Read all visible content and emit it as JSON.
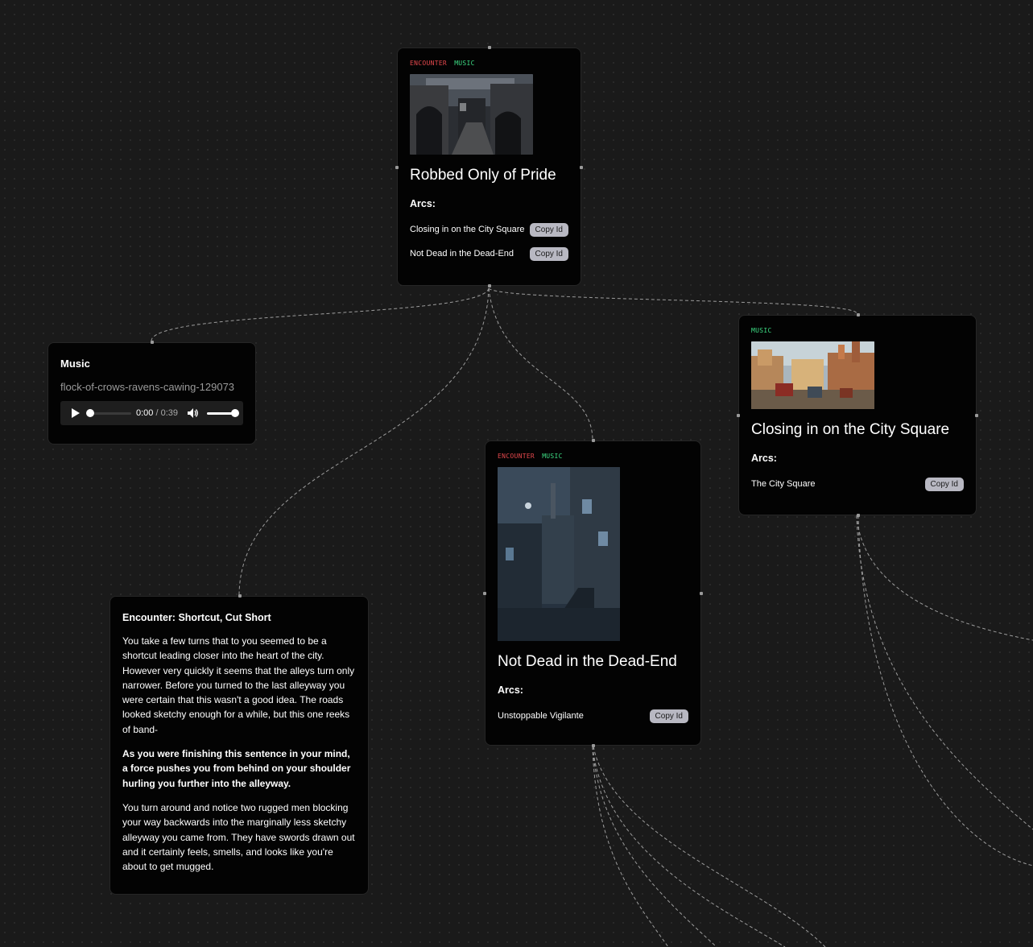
{
  "nodes": {
    "robbed": {
      "tags": [
        "ENCOUNTER",
        "MUSIC"
      ],
      "title": "Robbed Only of Pride",
      "arcs_label": "Arcs:",
      "arcs": [
        {
          "label": "Closing in on the City Square",
          "button": "Copy Id"
        },
        {
          "label": "Not Dead in the Dead-End",
          "button": "Copy Id"
        }
      ]
    },
    "music": {
      "title": "Music",
      "file": "flock-of-crows-ravens-cawing-129073",
      "current_time": "0:00",
      "duration": "/ 0:39",
      "progress": 0,
      "volume": 1
    },
    "city_square": {
      "tags": [
        "MUSIC"
      ],
      "title": "Closing in on the City Square",
      "arcs_label": "Arcs:",
      "arcs": [
        {
          "label": "The City Square",
          "button": "Copy Id"
        }
      ]
    },
    "dead_end": {
      "tags": [
        "ENCOUNTER",
        "MUSIC"
      ],
      "title": "Not Dead in the Dead-End",
      "arcs_label": "Arcs:",
      "arcs": [
        {
          "label": "Unstoppable Vigilante",
          "button": "Copy Id"
        }
      ]
    },
    "encounter": {
      "heading": "Encounter: Shortcut, Cut Short",
      "paragraphs": [
        "You take a few turns that to you seemed to be a shortcut leading closer into the heart of the city. However very quickly it seems that the alleys turn only narrower. Before you turned to the last alleyway you were certain that this wasn't a good idea. The roads looked sketchy enough for a while, but this one reeks of band-",
        "As you were finishing this sentence in your mind, a force pushes you from behind on your shoulder hurling you further into the alleyway.",
        "You turn around and notice two rugged men blocking your way backwards into the marginally less sketchy alleyway you came from. They have swords drawn out and it certainly feels, smells, and looks like you're about to get mugged."
      ]
    }
  },
  "colors": {
    "canvas": "#1a1a1a",
    "node_bg": "#030303",
    "tag_encounter": "#e5484d",
    "tag_music": "#3ddc84",
    "copy_button": "#b8b8c2",
    "edge": "#bdbdbd"
  }
}
